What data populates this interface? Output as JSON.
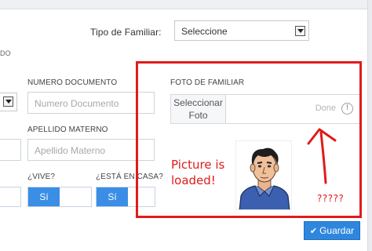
{
  "form": {
    "tipo_label": "Tipo de Familiar:",
    "tipo_value": "Seleccione",
    "left_fragment": "DO",
    "numero_doc_label": "NUMERO DOCUMENTO",
    "numero_doc_placeholder": "Numero Documento",
    "apellido_materno_label": "APELLIDO MATERNO",
    "apellido_materno_placeholder": "Apellido Materno",
    "vive_label": "¿VIVE?",
    "vive_value": "Sí",
    "casa_label": "¿ESTÁ EN CASA?",
    "casa_value": "Sí",
    "foto_label": "FOTO DE FAMILIAR",
    "foto_button_line1": "Seleccionar",
    "foto_button_line2": "Foto",
    "upload_status": "Done",
    "info_glyph": "!",
    "save_label": "Guardar",
    "save_icon": "check-icon"
  },
  "annotations": {
    "main_line1": "Picture is",
    "main_line2": "loaded!",
    "question": "?????"
  },
  "colors": {
    "accent": "#3a8ee6",
    "annotation": "#e01b1b",
    "save_button": "#2f87dd"
  }
}
